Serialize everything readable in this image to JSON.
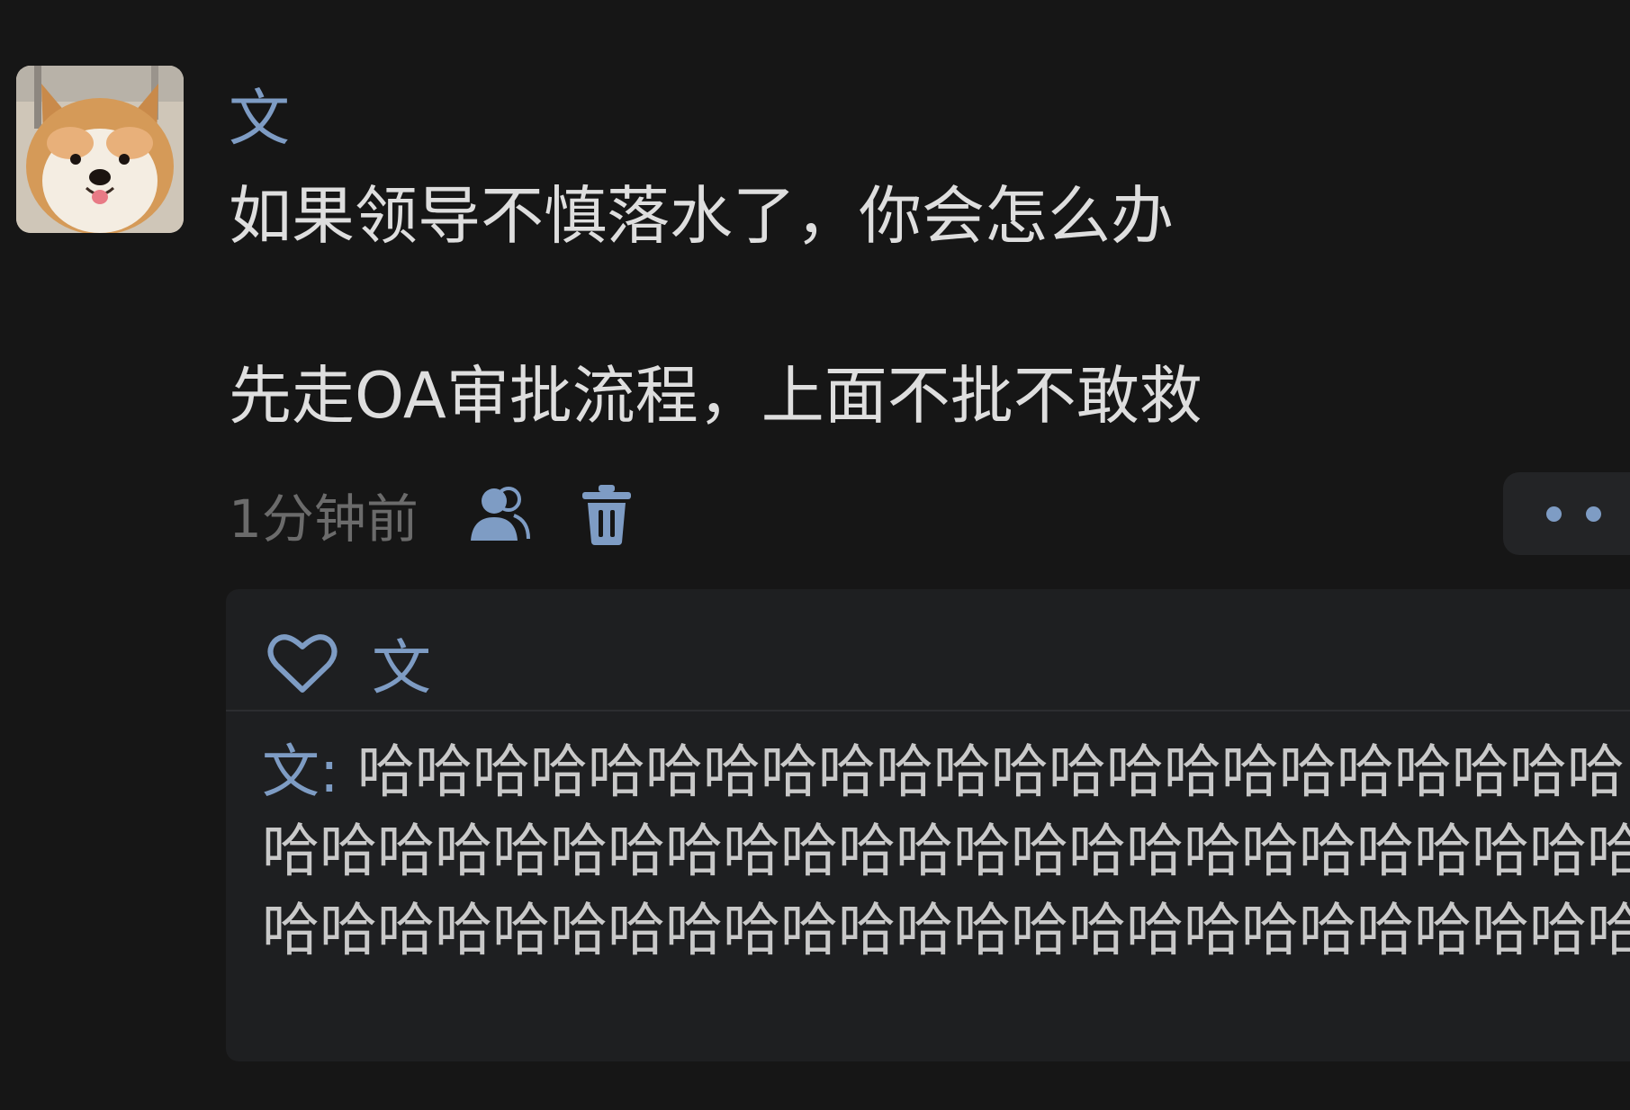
{
  "post": {
    "author": "文",
    "content_lines": [
      "如果领导不慎落水了，你会怎么办",
      "先走OA审批流程，上面不批不敢救"
    ],
    "timestamp": "1分钟前"
  },
  "icons": {
    "avatar": "shiba-dog-avatar",
    "visibility": "users-icon",
    "delete": "trash-icon",
    "more": "more-dots-icon",
    "like": "heart-icon"
  },
  "reactions": {
    "likers": "文",
    "comments": [
      {
        "author": "文",
        "separator": ": ",
        "text": "哈哈哈哈哈哈哈哈哈哈哈哈哈哈哈哈哈哈哈哈哈哈哈哈哈哈哈哈哈哈哈哈哈哈哈哈哈哈哈哈哈哈哈哈哈哈哈哈哈哈哈哈哈哈哈哈哈哈哈哈哈哈哈哈哈哈哈哈哈哈"
      }
    ]
  },
  "colors": {
    "background": "#161616",
    "accent": "#7e9cc4",
    "text": "#dedede",
    "muted": "#6b6b6b",
    "panel": "#1e1f21"
  }
}
